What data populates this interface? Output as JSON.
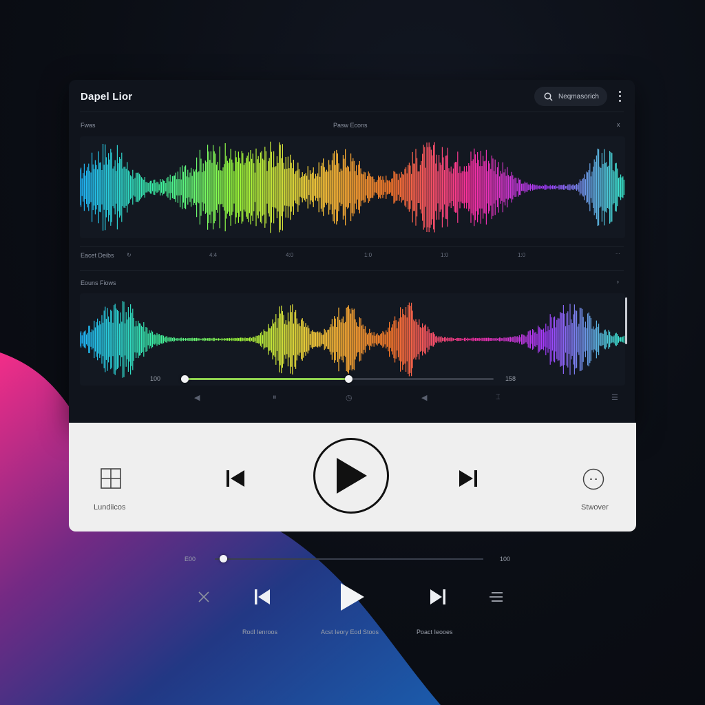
{
  "header": {
    "app_title": "Dapel Lior",
    "search_placeholder": "Neqmasorich"
  },
  "track_one": {
    "left_label": "Fwas",
    "center_label": "Pasw Econs",
    "close_symbol": "x"
  },
  "timeline_row": {
    "label": "Eacet Deibs",
    "ticks": [
      "4:4",
      "4:0",
      "1:0",
      "1:0",
      "1:0",
      "..."
    ]
  },
  "track_two": {
    "label": "Eouns Fiows",
    "time_start": "100",
    "time_end": "158",
    "progress": 0.53
  },
  "controls": {
    "left_label": "Lundiicos",
    "right_label": "Stwover"
  },
  "bottom": {
    "time_start": "E00",
    "time_end": "100",
    "labels": [
      "Rodl Ienroos",
      "Acst Ieory Eod Stoos",
      "Poact Ieooes"
    ],
    "progress": 0.03
  },
  "colors": {
    "accent_green": "#8ed14f",
    "wave_gradient": [
      "#1fb7ff",
      "#3cf0a0",
      "#9cff3a",
      "#ffd23a",
      "#ff7a2a",
      "#ff2fa0",
      "#a23cff",
      "#37f0d0"
    ]
  }
}
